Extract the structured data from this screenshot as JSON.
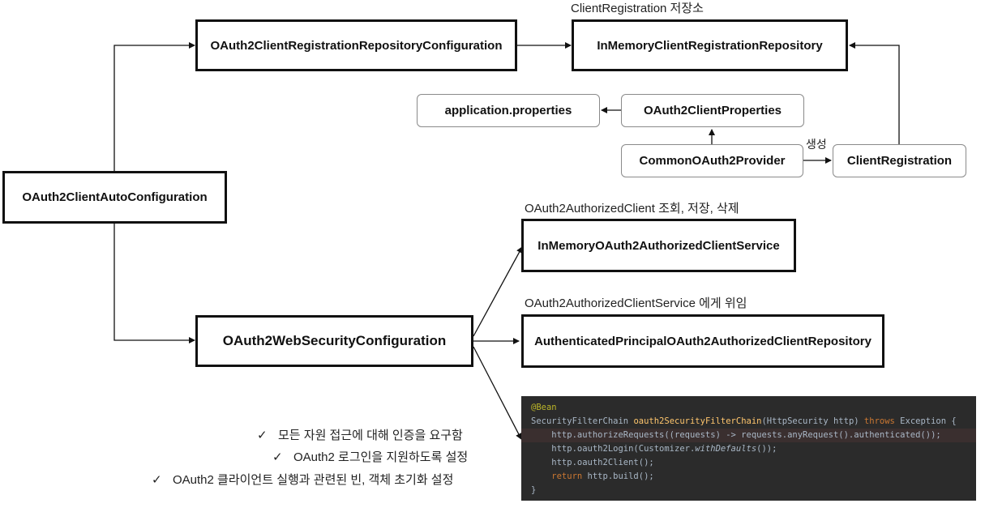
{
  "boxes": {
    "auto_config": "OAuth2ClientAutoConfiguration",
    "registration_repo_config": "OAuth2ClientRegistrationRepositoryConfiguration",
    "inmemory_registration_repo": "InMemoryClientRegistrationRepository",
    "application_properties": "application.properties",
    "client_properties": "OAuth2ClientProperties",
    "common_provider": "CommonOAuth2Provider",
    "client_registration": "ClientRegistration",
    "inmemory_authorized_service": "InMemoryOAuth2AuthorizedClientService",
    "web_security_config": "OAuth2WebSecurityConfiguration",
    "authenticated_principal_repo": "AuthenticatedPrincipalOAuth2AuthorizedClientRepository"
  },
  "labels": {
    "registration_store": "ClientRegistration 저장소",
    "create": "생성",
    "authorized_client_ops": "OAuth2AuthorizedClient 조회, 저장, 삭제",
    "delegate": "OAuth2AuthorizedClientService 에게 위임"
  },
  "checks": {
    "icon": "✓",
    "items": [
      "모든 자원 접근에 대해 인증을 요구함",
      "OAuth2 로그인을 지원하도록 설정",
      "OAuth2 클라이언트 실행과 관련된 빈, 객체 초기화 설정"
    ]
  },
  "code": {
    "annotation": "@Bean",
    "line1_type": "SecurityFilterChain ",
    "line1_method": "oauth2SecurityFilterChain",
    "line1_params": "(HttpSecurity http) ",
    "line1_throws": "throws",
    "line1_exception": " Exception {",
    "line2": "    http.authorizeRequests((requests) -> requests.anyRequest().authenticated());",
    "line3_start": "    http.oauth2Login(Customizer.",
    "line3_italic": "withDefaults",
    "line3_end": "());",
    "line4": "    http.oauth2Client();",
    "line5_return": "    return",
    "line5_rest": " http.build();",
    "line6": "}"
  },
  "colors": {
    "code_background": "#2b2b2b",
    "code_text": "#a9b7c6",
    "code_keyword": "#cc7832",
    "code_method": "#ffc66d",
    "code_annotation": "#bbb529"
  }
}
